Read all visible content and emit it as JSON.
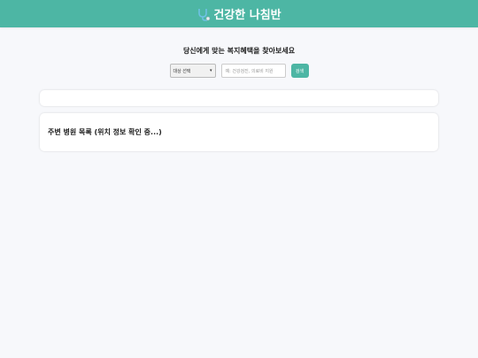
{
  "header": {
    "logo_icon": "stethoscope-icon",
    "title": "건강한 나침반"
  },
  "search": {
    "subtitle": "당신에게 맞는 복지혜택을 찾아보세요",
    "target_select": "대상 선택",
    "placeholder": "예: 건강검진, 의료비 지원",
    "button_label": "검색"
  },
  "results": {
    "empty_card": ""
  },
  "hospitals": {
    "title": "주변 병원 목록 (위치 정보 확인 중...)"
  },
  "colors": {
    "accent": "#4db6a4",
    "background": "#f7f8fb"
  }
}
